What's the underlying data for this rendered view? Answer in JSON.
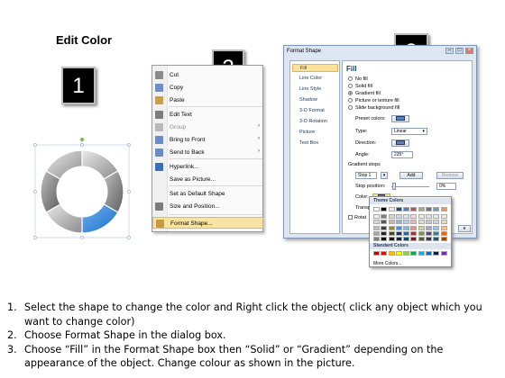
{
  "title": "Edit Color",
  "badges": {
    "one": "1",
    "two": "2",
    "three": "3"
  },
  "context_menu": {
    "items": [
      {
        "label": "Cut",
        "icon": "scissors-icon",
        "color": "#8a8a8a"
      },
      {
        "label": "Copy",
        "icon": "copy-icon",
        "color": "#6f8fc7"
      },
      {
        "label": "Paste",
        "icon": "paste-icon",
        "color": "#c9a04a"
      },
      {
        "label": "Edit Text",
        "icon": "edit-text-icon",
        "color": "#7d7d7d"
      },
      {
        "label": "Group",
        "icon": "group-icon",
        "color": "#b9b9b9",
        "disabled": true,
        "submenu": true
      },
      {
        "label": "Bring to Front",
        "icon": "bring-front-icon",
        "color": "#6a8bc3",
        "submenu": true
      },
      {
        "label": "Send to Back",
        "icon": "send-back-icon",
        "color": "#6a8bc3",
        "submenu": true
      },
      {
        "label": "Hyperlink...",
        "icon": "hyperlink-icon",
        "color": "#3d6fb6"
      },
      {
        "label": "Save as Picture...",
        "icon": "",
        "color": ""
      },
      {
        "label": "Set as Default Shape",
        "icon": "",
        "color": ""
      },
      {
        "label": "Size and Position...",
        "icon": "size-icon",
        "color": "#7b7b7b"
      },
      {
        "label": "Format Shape...",
        "icon": "format-shape-icon",
        "color": "#c89a3c",
        "highlighted": true
      }
    ]
  },
  "dialog": {
    "title": "Format Shape",
    "nav": [
      "Fill",
      "Line Color",
      "Line Style",
      "Shadow",
      "3-D Format",
      "3-D Rotation",
      "Picture",
      "Text Box"
    ],
    "nav_selected": "Fill",
    "pane_title": "Fill",
    "fill_options": [
      "No fill",
      "Solid fill",
      "Gradient fill",
      "Picture or texture fill",
      "Slide background fill"
    ],
    "fill_selected": "Gradient fill",
    "preset_label": "Preset colors:",
    "type_label": "Type:",
    "type_value": "Linear",
    "direction_label": "Direction:",
    "angle_label": "Angle:",
    "angle_value": "225°",
    "gradient_stops_label": "Gradient stops",
    "stop_value": "Stop 1",
    "add_label": "Add",
    "remove_label": "Remove",
    "stop_position_label": "Stop position:",
    "stop_position_value": "0%",
    "color_label": "Color:",
    "transparency_label": "Transpa",
    "rotate_label": "Rotat",
    "close_label": "e"
  },
  "palette": {
    "theme_label": "Theme Colors",
    "standard_label": "Standard Colors",
    "more_label": "More Colors...",
    "theme_top": [
      "#ffffff",
      "#000000",
      "#eeece1",
      "#1f497d",
      "#4f81bd",
      "#c0504d",
      "#9bbb59",
      "#8064a2",
      "#4bacc6",
      "#f79646"
    ],
    "theme_tints": [
      [
        "#f2f2f2",
        "#7f7f7f",
        "#ddd9c3",
        "#c6d9f0",
        "#dbe5f1",
        "#f2dcdb",
        "#ebf1dd",
        "#e5e0ec",
        "#dbeef3",
        "#fdeada"
      ],
      [
        "#d8d8d8",
        "#595959",
        "#c4bd97",
        "#8db3e2",
        "#b8cce4",
        "#e5b9b7",
        "#d7e3bc",
        "#ccc1d9",
        "#b7dde8",
        "#fbd5b5"
      ],
      [
        "#bfbfbf",
        "#3f3f3f",
        "#938953",
        "#548dd4",
        "#95b3d7",
        "#d99694",
        "#c3d69b",
        "#b2a2c7",
        "#92cddc",
        "#fac08f"
      ],
      [
        "#a5a5a5",
        "#262626",
        "#494429",
        "#17365d",
        "#366092",
        "#953734",
        "#76923c",
        "#5f497a",
        "#31859b",
        "#e36c09"
      ],
      [
        "#7f7f7f",
        "#0c0c0c",
        "#1d1b10",
        "#0f243e",
        "#244061",
        "#632423",
        "#4f6128",
        "#3f3151",
        "#205867",
        "#974806"
      ]
    ],
    "standard": [
      "#c00000",
      "#ff0000",
      "#ffc000",
      "#ffff00",
      "#92d050",
      "#00b050",
      "#00b0f0",
      "#0070c0",
      "#002060",
      "#7030a0"
    ]
  },
  "steps": [
    {
      "num": "1.",
      "text": "Select the shape to change the color and Right click the object( click any object which you want to change color)"
    },
    {
      "num": "2.",
      "text": "Choose Format Shape in the dialog box."
    },
    {
      "num": "3.",
      "text": "Choose “Fill” in the Format Shape box then “Solid” or “Gradient” depending on the appearance of the object. Change colour as shown in the picture."
    }
  ]
}
